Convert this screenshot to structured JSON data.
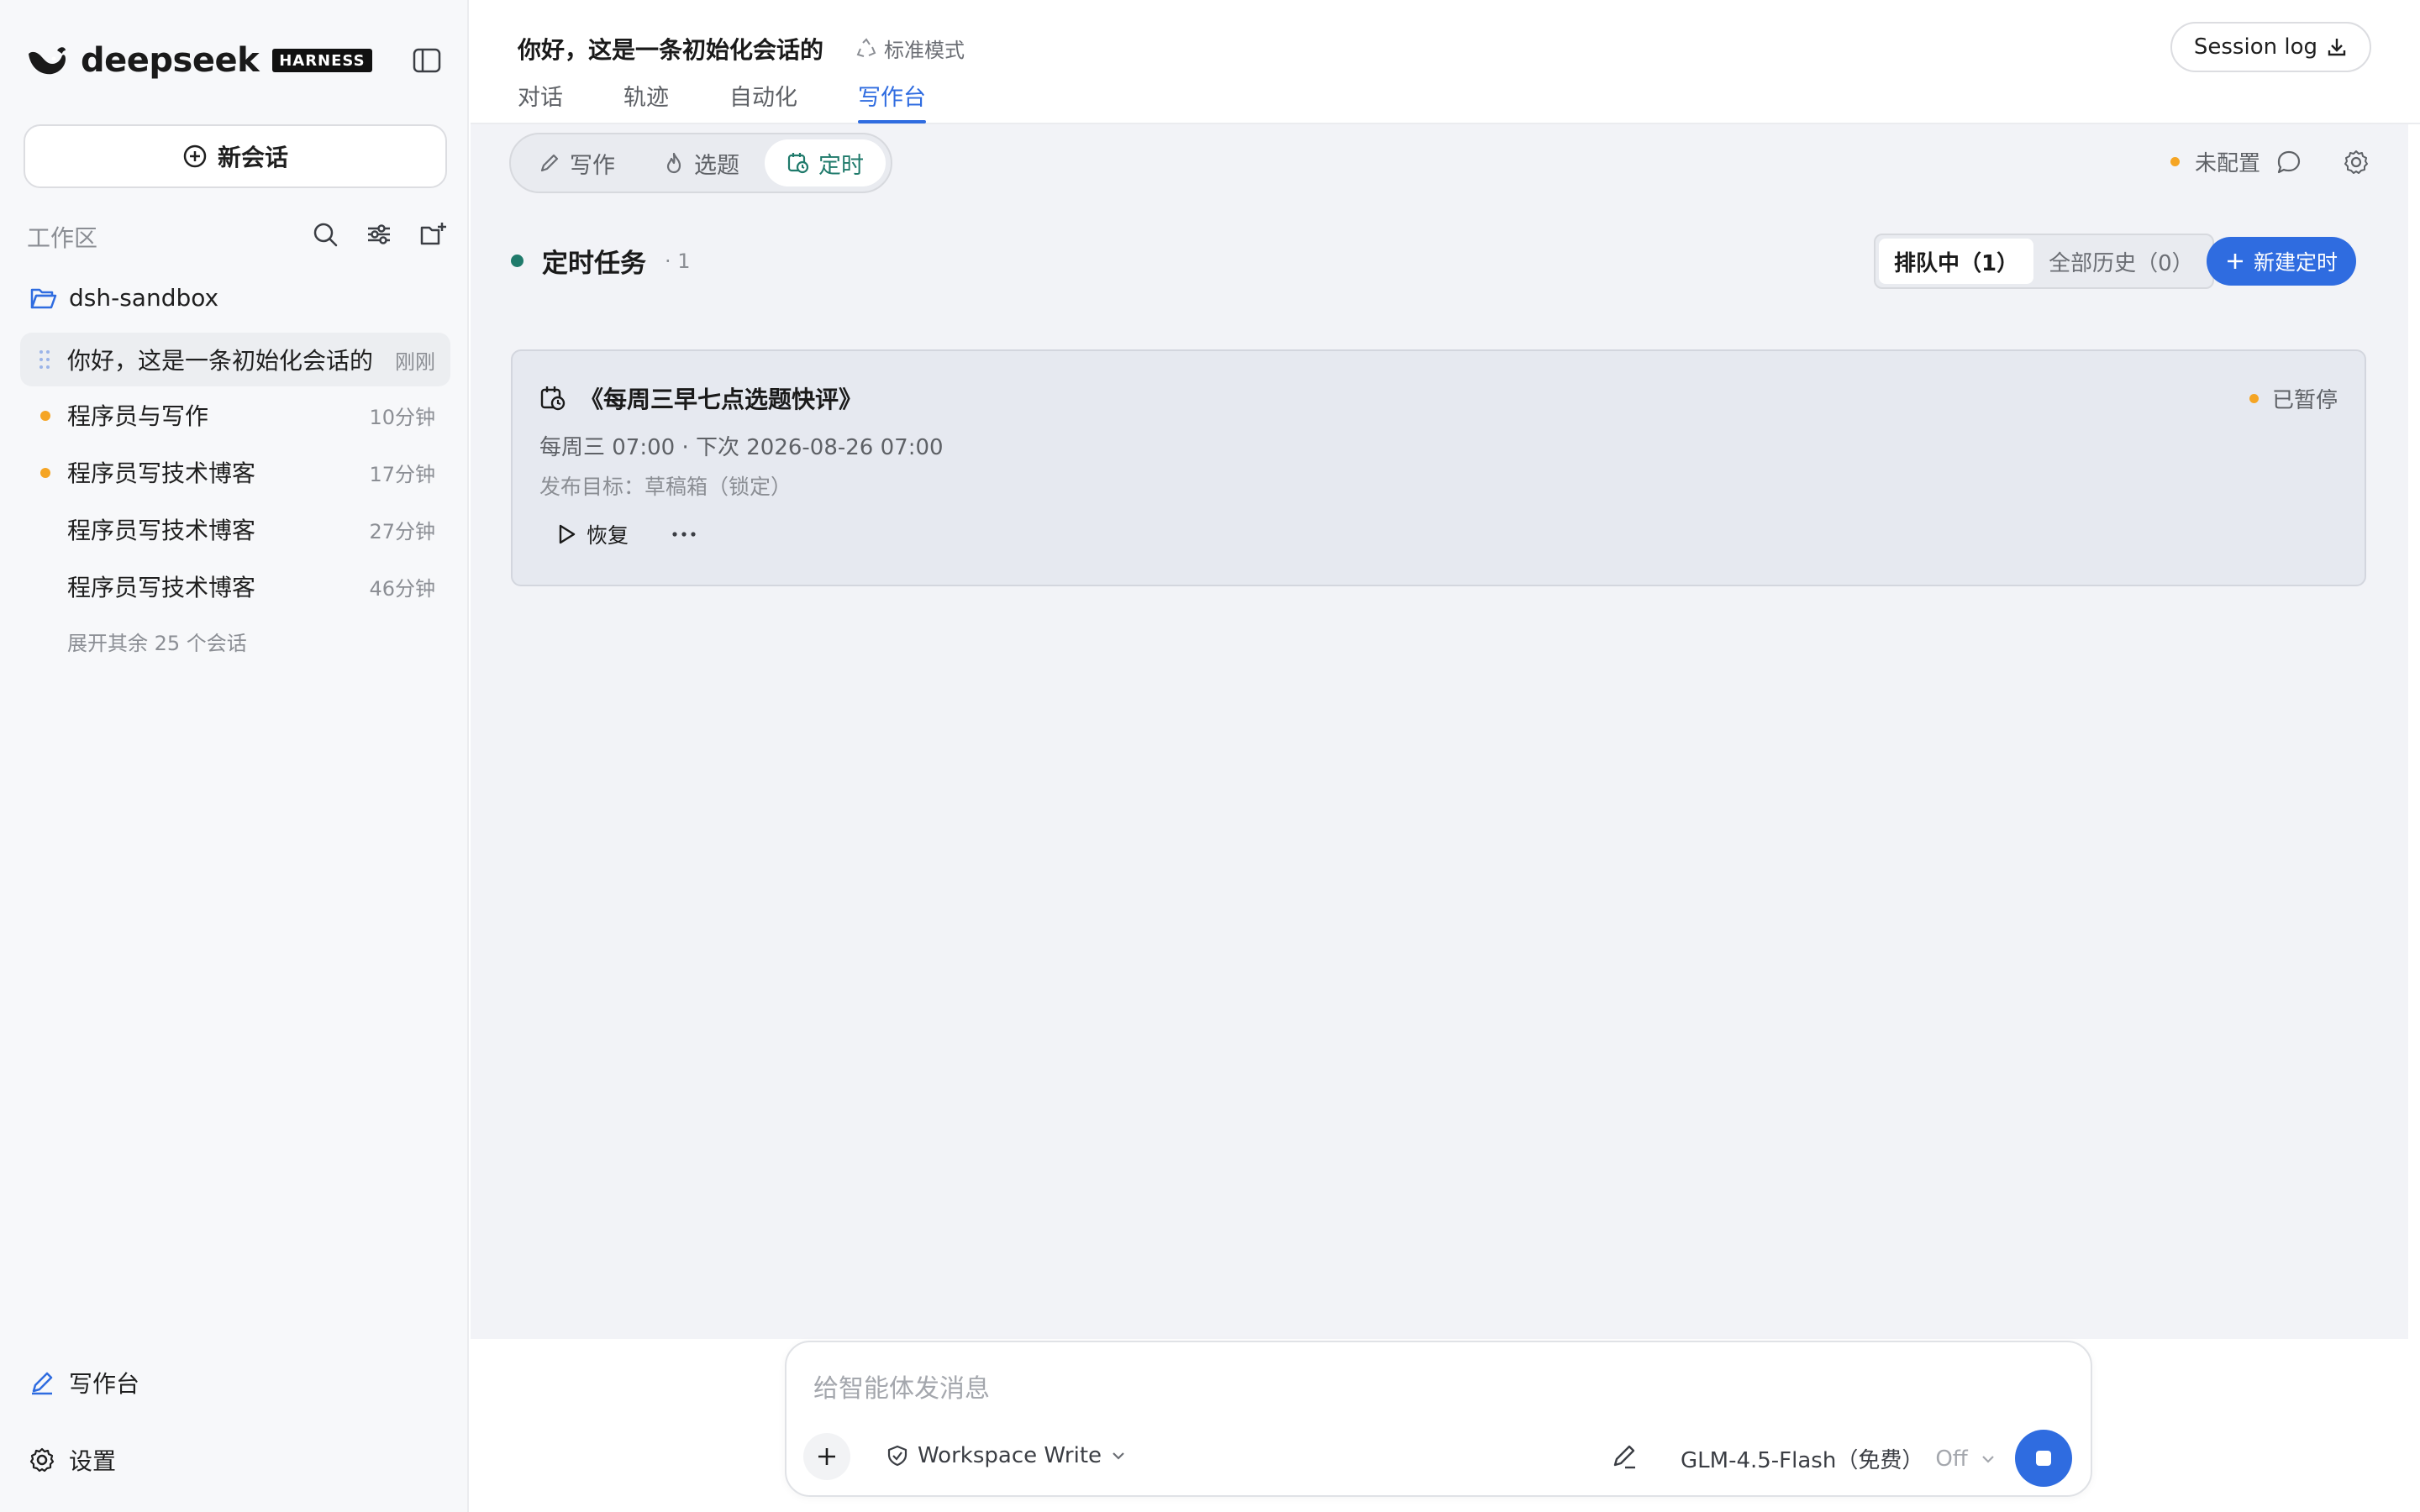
{
  "sidebar": {
    "brand_name": "deepseek",
    "brand_badge": "HARNESS",
    "new_chat_label": "新会话",
    "workspace_label": "工作区",
    "folder_name": "dsh-sandbox",
    "sessions": [
      {
        "title": "你好，这是一条初始化会话的",
        "time": "刚刚",
        "active": true,
        "unread": false
      },
      {
        "title": "程序员与写作",
        "time": "10分钟",
        "active": false,
        "unread": true
      },
      {
        "title": "程序员写技术博客",
        "time": "17分钟",
        "active": false,
        "unread": true
      },
      {
        "title": "程序员写技术博客",
        "time": "27分钟",
        "active": false,
        "unread": false
      },
      {
        "title": "程序员写技术博客",
        "time": "46分钟",
        "active": false,
        "unread": false
      }
    ],
    "expand_more": "展开其余 25 个会话",
    "footer": {
      "writing_desk": "写作台",
      "settings": "设置"
    }
  },
  "header": {
    "title": "你好，这是一条初始化会话的",
    "mode": "标准模式",
    "tabs": [
      "对话",
      "轨迹",
      "自动化",
      "写作台"
    ],
    "active_tab": "写作台",
    "session_log": "Session log"
  },
  "main": {
    "segments": [
      "写作",
      "选题",
      "定时"
    ],
    "active_segment": "定时",
    "config_status": "未配置",
    "task_section_title": "定时任务",
    "task_count": "· 1",
    "filters": [
      "排队中（1）",
      "全部历史（0）"
    ],
    "new_timer": "新建定时",
    "task": {
      "title": "《每周三早七点选题快评》",
      "status": "已暂停",
      "schedule": "每周三 07:00 · 下次 2026-08-26 07:00",
      "target": "发布目标：草稿箱（锁定）",
      "resume_label": "恢复"
    }
  },
  "composer": {
    "placeholder": "给智能体发消息",
    "permission": "Workspace Write",
    "model": "GLM-4.5-Flash（免费）",
    "thinking": "Off"
  },
  "colors": {
    "accent": "#2f6ce0",
    "green": "#1f7a6b",
    "orange": "#f5a524"
  }
}
